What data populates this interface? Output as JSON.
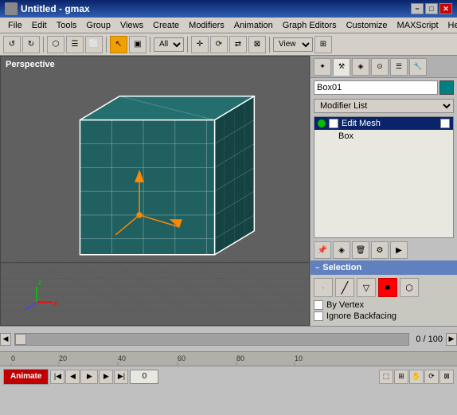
{
  "titlebar": {
    "title": "Untitled - gmax",
    "min_label": "−",
    "max_label": "□",
    "close_label": "✕"
  },
  "menubar": {
    "items": [
      "File",
      "Edit",
      "Tools",
      "Group",
      "Views",
      "Create",
      "Modifiers",
      "Animation",
      "Graph Editors",
      "Customize",
      "MAXScript",
      "Help"
    ]
  },
  "toolbar": {
    "select_label": "All",
    "view_label": "View"
  },
  "viewport": {
    "label": "Perspective"
  },
  "right_panel": {
    "name_value": "Box01",
    "modifier_list_placeholder": "Modifier List",
    "stack_items": [
      {
        "name": "Edit Mesh",
        "selected": true
      },
      {
        "name": "Box",
        "selected": false
      }
    ]
  },
  "selection_section": {
    "title": "Selection",
    "by_vertex_label": "By Vertex",
    "ignore_backfacing_label": "Ignore Backfacing"
  },
  "timeline": {
    "counter": "0 / 100",
    "frame_value": "0"
  },
  "ruler": {
    "labels": [
      "0",
      "20",
      "40",
      "60",
      "80",
      "10"
    ]
  },
  "animate_btn_label": "Animate",
  "nav_btns": {
    "prev_key": "|◀",
    "prev": "◀",
    "play": "▶",
    "next": "▶|",
    "prev_frame": "◀",
    "next_frame": "▶",
    "next_key": "▶|"
  }
}
